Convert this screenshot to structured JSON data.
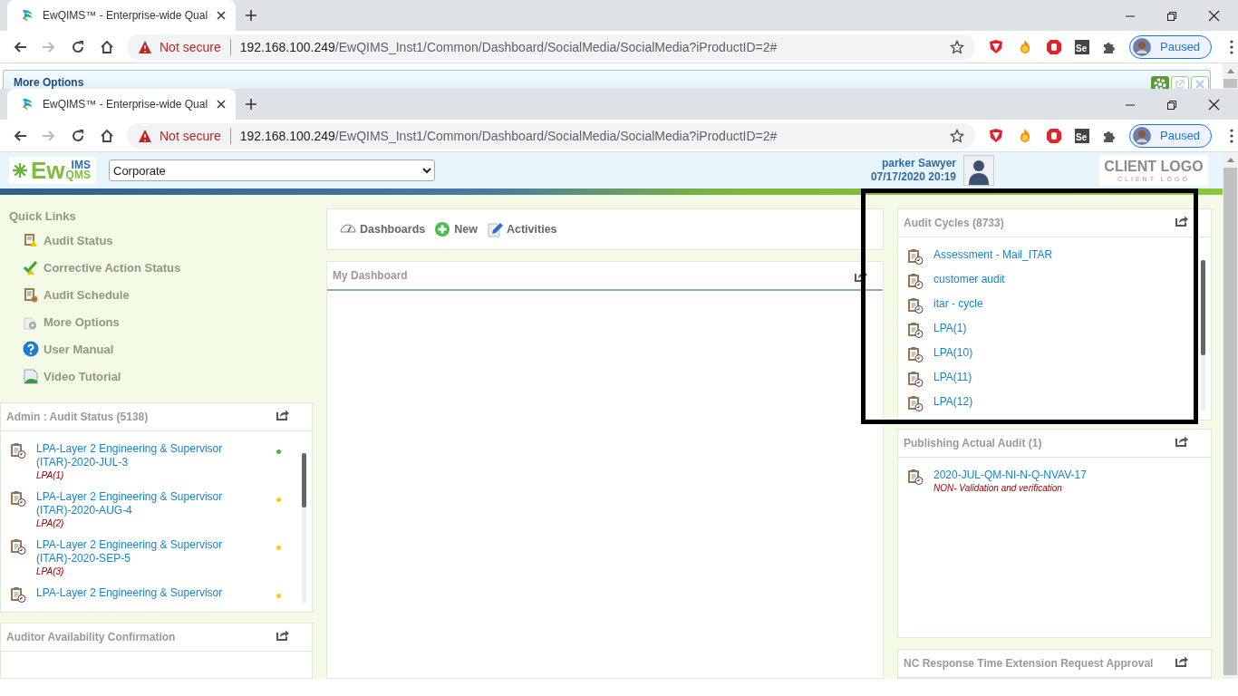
{
  "windows": [
    {
      "tab": {
        "title": "EwQIMS™ - Enterprise-wide Qual"
      },
      "toolbar": {
        "forward_disabled": true,
        "security": "Not secure",
        "url_host": "192.168.100.249",
        "url_path": "/EwQIMS_Inst1/Common/Dashboard/SocialMedia/SocialMedia?iProductID=2#",
        "extension_label": "Se",
        "profile_status": "Paused"
      },
      "page": {
        "kind": "strip",
        "panel_title": "More Options"
      }
    },
    {
      "tab": {
        "title": "EwQIMS™ - Enterprise-wide Qual"
      },
      "toolbar": {
        "forward_disabled": true,
        "security": "Not secure",
        "url_host": "192.168.100.249",
        "url_path": "/EwQIMS_Inst1/Common/Dashboard/SocialMedia/SocialMedia?iProductID=2#",
        "extension_label": "Se",
        "profile_status": "Paused"
      },
      "page": {
        "kind": "dashboard"
      }
    }
  ],
  "dashboard": {
    "header": {
      "logo": {
        "main": "Ew",
        "top": "IMS",
        "bottom": "QMS"
      },
      "site_select": {
        "value": "Corporate"
      },
      "user_name": "parker Sawyer",
      "datetime": "07/17/2020 20:19",
      "client_logo": {
        "title": "CLIENT LOGO",
        "subtitle": "CLIENT LOGO"
      }
    },
    "quick_links": {
      "title": "Quick Links",
      "items": [
        "Audit Status",
        "Corrective Action Status",
        "Audit Schedule",
        "More Options",
        "User Manual",
        "Video Tutorial"
      ]
    },
    "left_panels": [
      {
        "title": "Admin : Audit Status (5138)",
        "items": [
          {
            "title": "LPA-Layer 2 Engineering & Supervisor (ITAR)-2020-JUL-3",
            "subtitle": "LPA(1)",
            "color": "#4caf50"
          },
          {
            "title": "LPA-Layer 2 Engineering & Supervisor (ITAR)-2020-AUG-4",
            "subtitle": "LPA(2)",
            "color": "#f5d000"
          },
          {
            "title": "LPA-Layer 2 Engineering & Supervisor (ITAR)-2020-SEP-5",
            "subtitle": "LPA(3)",
            "color": "#f5d000"
          },
          {
            "title": "LPA-Layer 2 Engineering & Supervisor",
            "color": "#f5d000"
          }
        ]
      },
      {
        "title": "Auditor Availability Confirmation"
      }
    ],
    "toolbar": {
      "items": [
        "Dashboards",
        "New",
        "Activities"
      ]
    },
    "main_panel": {
      "title": "My Dashboard"
    },
    "right_panels": [
      {
        "title": "Audit Cycles (8733)",
        "items": [
          {
            "title": "Assessment - Mail_ITAR"
          },
          {
            "title": "customer audit"
          },
          {
            "title": "itar - cycle"
          },
          {
            "title": "LPA(1)"
          },
          {
            "title": "LPA(10)"
          },
          {
            "title": "LPA(11)"
          },
          {
            "title": "LPA(12)"
          }
        ]
      },
      {
        "title": "Publishing Actual Audit (1)",
        "items": [
          {
            "title": "2020-JUL-QM-NI-N-Q-NVAV-17",
            "subtitle": "NON- Validation and verification"
          }
        ]
      },
      {
        "title": "NC Response Time Extension Request Approval"
      }
    ]
  }
}
